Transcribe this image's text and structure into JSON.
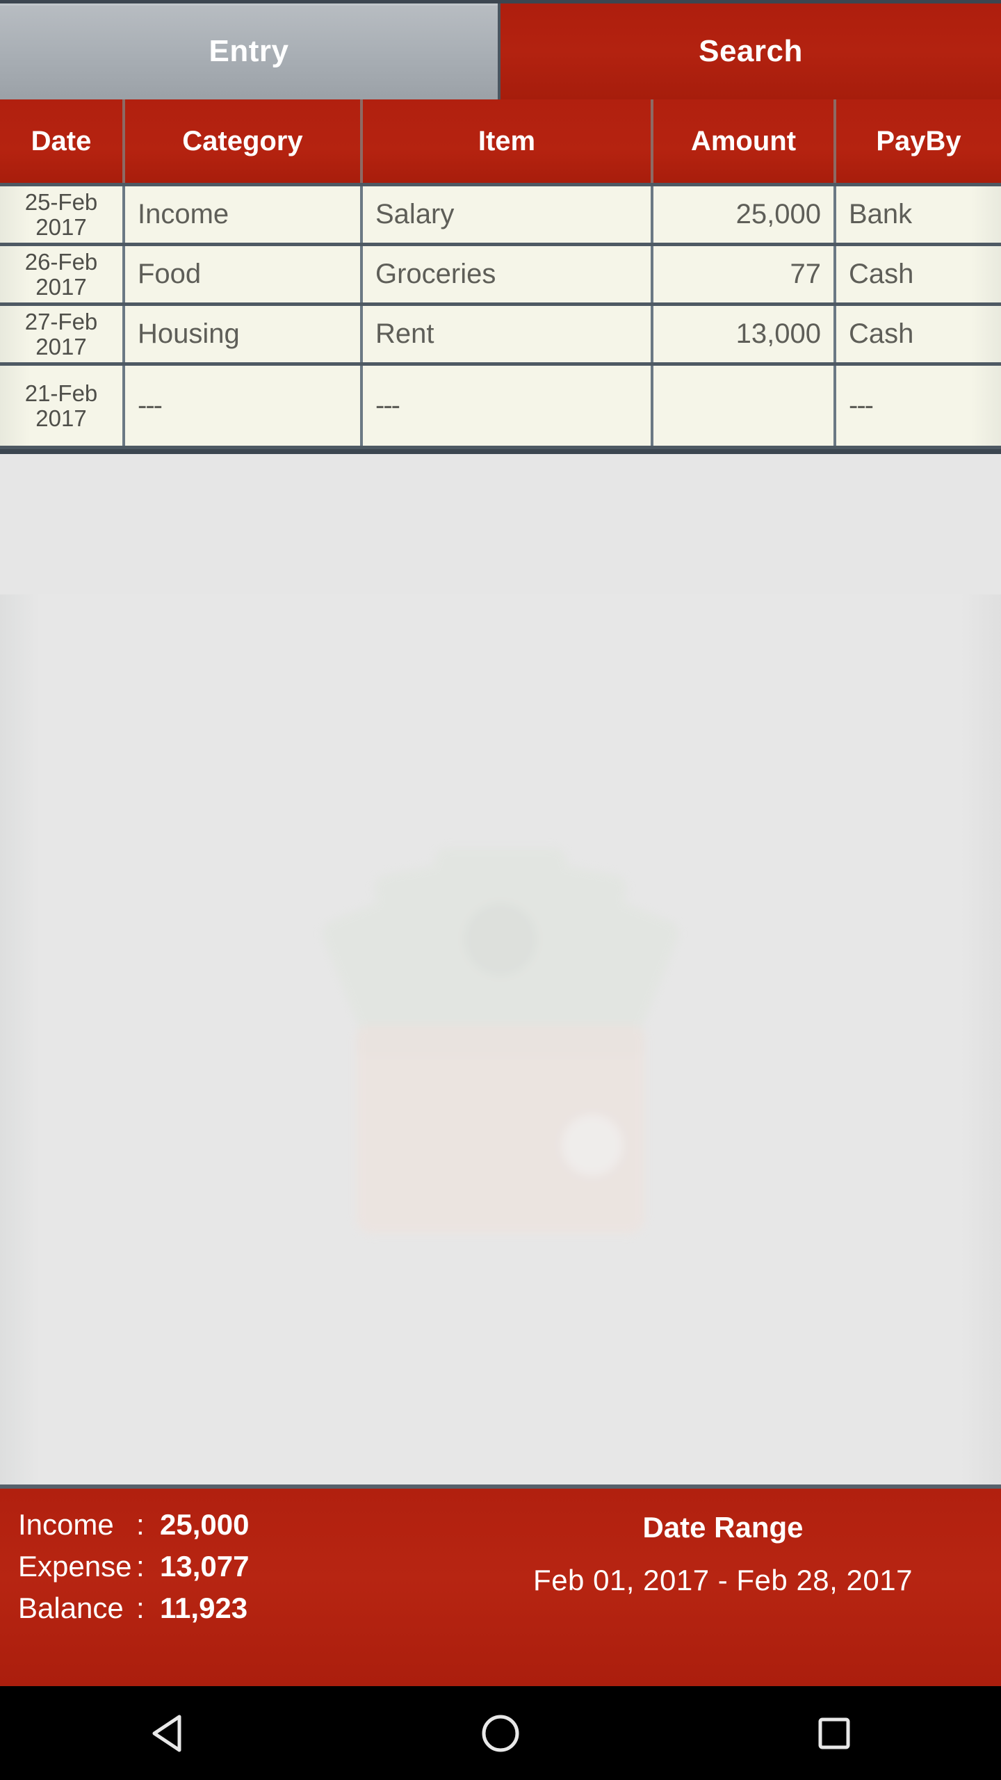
{
  "tabs": [
    {
      "label": "Entry",
      "name": "tab-entry",
      "selected": true
    },
    {
      "label": "Search",
      "name": "tab-search",
      "selected": false
    }
  ],
  "table": {
    "columns": [
      "Date",
      "Category",
      "Item",
      "Amount",
      "PayBy"
    ],
    "rows": [
      {
        "date_day": "25-Feb",
        "date_year": "2017",
        "category": "Income",
        "item": "Salary",
        "amount": "25,000",
        "payby": "Bank"
      },
      {
        "date_day": "26-Feb",
        "date_year": "2017",
        "category": "Food",
        "item": "Groceries",
        "amount": "77",
        "payby": "Cash"
      },
      {
        "date_day": "27-Feb",
        "date_year": "2017",
        "category": "Housing",
        "item": "Rent",
        "amount": "13,000",
        "payby": "Cash"
      },
      {
        "date_day": "21-Feb",
        "date_year": "2017",
        "category": "---",
        "item": "---",
        "amount": "",
        "payby": "---"
      }
    ]
  },
  "summary": {
    "income_label": "Income",
    "income_value": "25,000",
    "expense_label": "Expense",
    "expense_value": "13,077",
    "balance_label": "Balance",
    "balance_value": "11,923",
    "colon": ":",
    "daterange_title": "Date Range",
    "daterange_value": "Feb 01, 2017  -  Feb 28, 2017"
  },
  "navbar": {
    "back": "back-triangle-icon",
    "home": "home-circle-icon",
    "recents": "recents-square-icon"
  },
  "colors": {
    "brand_red": "#b1200f",
    "tab_selected_gray": "#a8aeb4",
    "cell_bg": "#f5f5e8",
    "grid_line": "#4e5963",
    "content_bg": "#e7e7e7"
  },
  "watermark": "wallet-with-banknotes-icon"
}
